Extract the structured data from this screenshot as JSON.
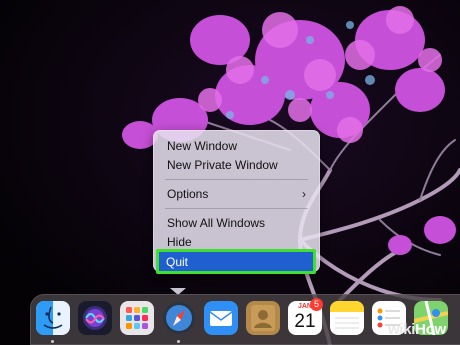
{
  "context_menu": {
    "items": [
      {
        "label": "New Window"
      },
      {
        "label": "New Private Window"
      },
      {
        "label": "Options"
      },
      {
        "label": "Show All Windows"
      },
      {
        "label": "Hide"
      },
      {
        "label": "Quit"
      }
    ],
    "options_chevron": "›",
    "highlight_color": "#3fe02e",
    "selected_color": "#1f5fd0"
  },
  "dock": {
    "apps": [
      {
        "name": "finder-icon"
      },
      {
        "name": "siri-icon"
      },
      {
        "name": "launchpad-icon"
      },
      {
        "name": "safari-icon"
      },
      {
        "name": "mail-icon"
      },
      {
        "name": "contacts-icon"
      },
      {
        "name": "calendar-icon",
        "month": "JAN",
        "day": "21",
        "badge": "5"
      },
      {
        "name": "notes-icon"
      },
      {
        "name": "reminders-icon"
      },
      {
        "name": "maps-icon"
      }
    ]
  },
  "watermark": {
    "part1": "wiki",
    "part2": "How"
  }
}
